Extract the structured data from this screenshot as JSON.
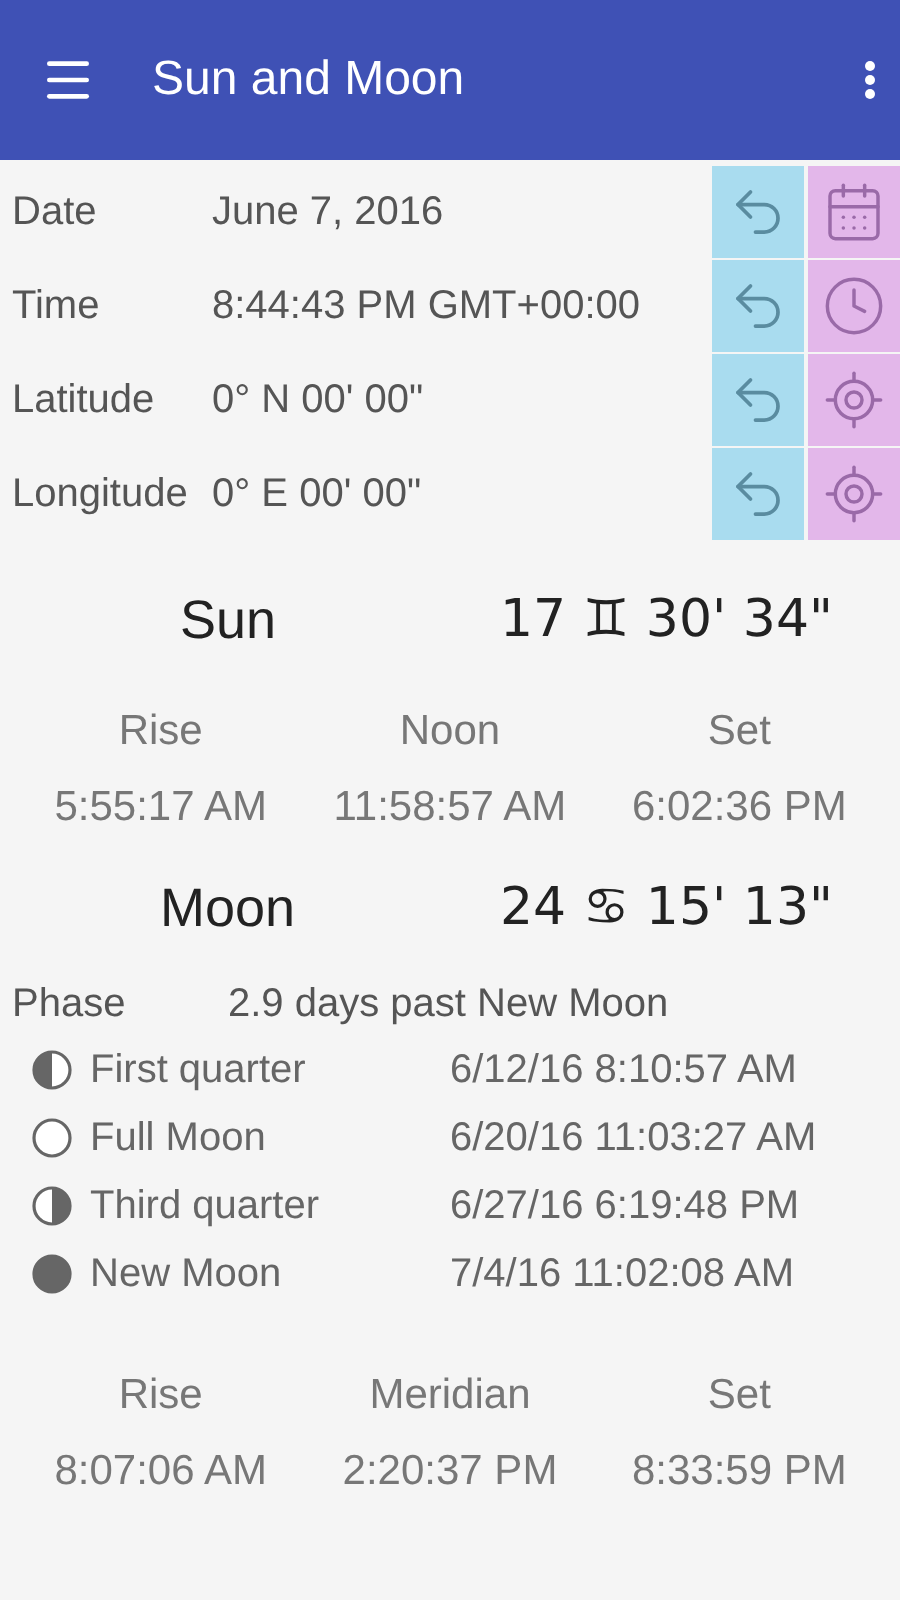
{
  "app_bar": {
    "title": "Sun and Moon"
  },
  "fields": [
    {
      "label": "Date",
      "value": "June 7, 2016",
      "kind": "calendar"
    },
    {
      "label": "Time",
      "value": "8:44:43 PM GMT+00:00",
      "kind": "clock"
    },
    {
      "label": "Latitude",
      "value": "0° N 00' 00\"",
      "kind": "location"
    },
    {
      "label": "Longitude",
      "value": "0° E 00' 00\"",
      "kind": "location"
    }
  ],
  "sun": {
    "name": "Sun",
    "position": "17 ♊ 30' 34\"",
    "events": [
      {
        "label": "Rise",
        "time": "5:55:17 AM"
      },
      {
        "label": "Noon",
        "time": "11:58:57 AM"
      },
      {
        "label": "Set",
        "time": "6:02:36 PM"
      }
    ]
  },
  "moon": {
    "name": "Moon",
    "position": "24 ♋ 15' 13\"",
    "phase_label": "Phase",
    "phase": "2.9 days past New Moon",
    "phases": [
      {
        "kind": "first_quarter",
        "name": "First quarter",
        "time": "6/12/16 8:10:57 AM"
      },
      {
        "kind": "full",
        "name": "Full Moon",
        "time": "6/20/16 11:03:27 AM"
      },
      {
        "kind": "third_quarter",
        "name": "Third quarter",
        "time": "6/27/16 6:19:48 PM"
      },
      {
        "kind": "new",
        "name": "New Moon",
        "time": "7/4/16 11:02:08 AM"
      }
    ],
    "events": [
      {
        "label": "Rise",
        "time": "8:07:06 AM"
      },
      {
        "label": "Meridian",
        "time": "2:20:37 PM"
      },
      {
        "label": "Set",
        "time": "8:33:59 PM"
      }
    ]
  }
}
